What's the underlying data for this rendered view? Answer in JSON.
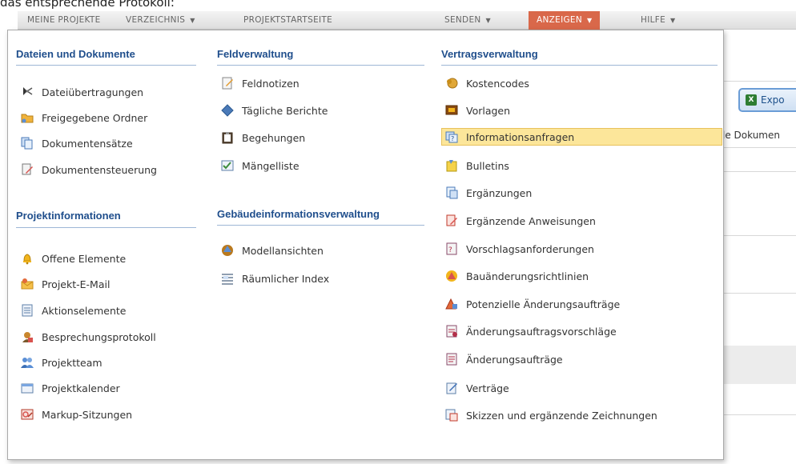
{
  "caption": "das entsprechende Protokoll:",
  "nav": {
    "items": [
      {
        "label": "MEINE PROJEKTE",
        "caret": ""
      },
      {
        "label": "VERZEICHNIS",
        "caret": "▼"
      },
      {
        "label": "PROJEKTSTARTSEITE",
        "caret": ""
      },
      {
        "label": "SENDEN",
        "caret": "▼"
      },
      {
        "label": "ANZEIGEN",
        "caret": "▼"
      },
      {
        "label": "HILFE",
        "caret": "▼"
      }
    ]
  },
  "background": {
    "export_label": "Expo",
    "doc_text": "le Dokumen"
  },
  "menu": {
    "files": {
      "title": "Dateien und Dokumente",
      "items": [
        "Dateiübertragungen",
        "Freigegebene Ordner",
        "Dokumentensätze",
        "Dokumentensteuerung"
      ]
    },
    "project_info": {
      "title": "Projektinformationen",
      "items": [
        "Offene Elemente",
        "Projekt-E-Mail",
        "Aktionselemente",
        "Besprechungsprotokoll",
        "Projektteam",
        "Projektkalender",
        "Markup-Sitzungen"
      ]
    },
    "field": {
      "title": "Feldverwaltung",
      "items": [
        "Feldnotizen",
        "Tägliche Berichte",
        "Begehungen",
        "Mängelliste"
      ]
    },
    "building": {
      "title": "Gebäudeinformationsverwaltung",
      "items": [
        "Modellansichten",
        "Räumlicher Index"
      ]
    },
    "contract": {
      "title": "Vertragsverwaltung",
      "items": [
        "Kostencodes",
        "Vorlagen",
        "Informationsanfragen",
        "Bulletins",
        "Ergänzungen",
        "Ergänzende Anweisungen",
        "Vorschlagsanforderungen",
        "Bauänderungsrichtlinien",
        "Potenzielle Änderungsaufträge",
        "Änderungsauftragsvorschläge",
        "Änderungsaufträge",
        "Verträge",
        "Skizzen und ergänzende Zeichnungen"
      ],
      "highlighted": "Informationsanfragen"
    }
  },
  "colors": {
    "accent": "#d9684a",
    "section_heading": "#1f4e8c",
    "highlight": "#fce69a"
  }
}
